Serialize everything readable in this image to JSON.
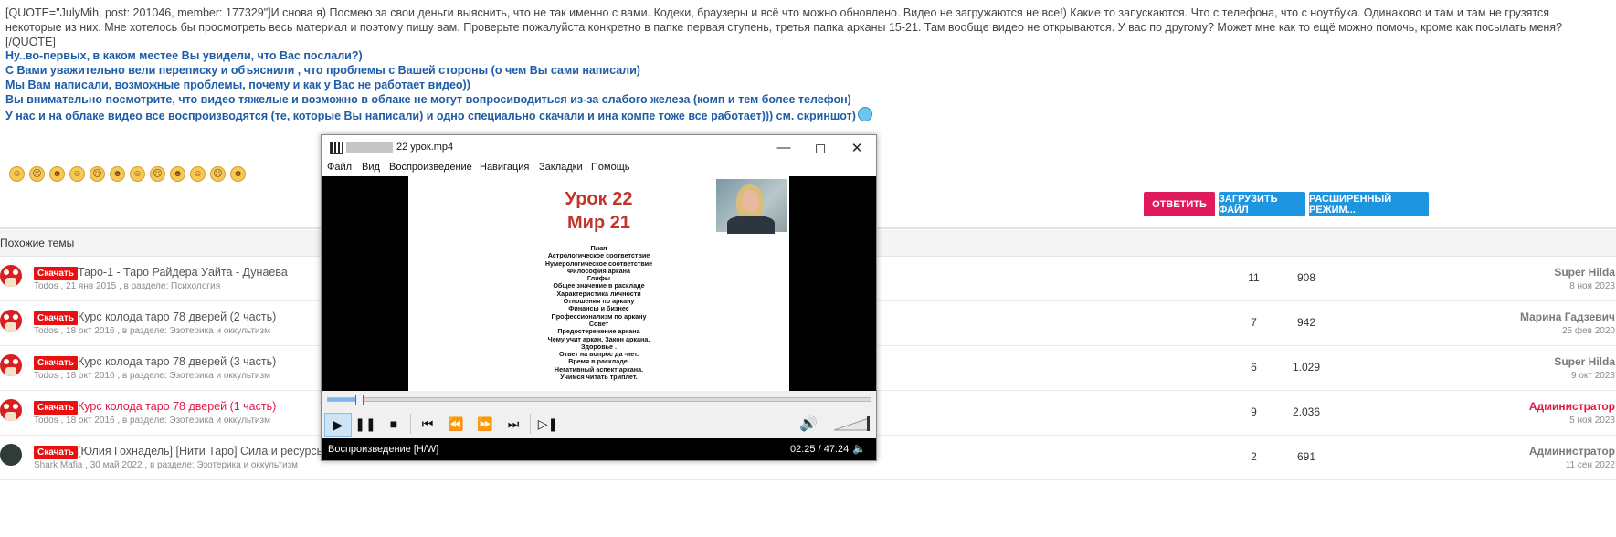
{
  "post": {
    "quote_text": "[QUOTE=\"JulyMih, post: 201046, member: 177329\"]И снова я) Посмею за свои деньги выяснить, что не так именно с вами. Кодеки, браузеры и всё что можно обновлено. Видео не загружаются не все!) Какие то запускаются. Что с телефона, что с ноутбука. Одинаково и там и там не грузятся некоторые из них. Мне хотелось бы просмотреть весь материал и поэтому пишу вам. Проверьте пожалуйста конкретно в папке первая ступень, третья папка арканы 15-21. Там вообще видео не открываются. У вас по другому? Может мне как то ещё можно помочь, кроме как посылать меня?",
    "quote_end": "[/QUOTE]",
    "reply_lines": [
      "Ну..во-первых, в каком местее Вы увидели, что Вас послали?)",
      "С Вами уважительно вели переписку и объяснили , что проблемы с Вашей стороны (о чем Вы сами написали)",
      "Мы Вам написали, возможные проблемы, почему и как у Вас не работает видео))",
      "Вы внимательно посмотрите, что видео тяжелые и возможно в облаке не могут вопросиводиться из-за слабого железа (комп и тем более телефон)",
      "У нас и на облаке видео все воспроизводятся (те, которые Вы написали) и одно специально скачали и ина компе тоже все работает))) см. скриншот)"
    ]
  },
  "smilies": [
    "☺",
    "☹",
    "☻",
    "☺",
    "☹",
    "☻",
    "☺",
    "☹",
    "☻",
    "☺",
    "☹",
    "☻"
  ],
  "buttons": {
    "reply": "ОТВЕТИТЬ",
    "upload": "ЗАГРУЗИТЬ ФАЙЛ",
    "advanced": "РАСШИРЕННЫЙ РЕЖИМ..."
  },
  "similar": {
    "heading": "Похожие темы",
    "threads": [
      {
        "badge": "Скачать",
        "title": "Таро-1 - Таро Райдера Уайта - Дунаева",
        "meta": "Todos , 21 янв 2015 , в разделе: Психология",
        "replies": "11",
        "views": "908",
        "last_user": "Super Hilda",
        "last_date": "8 ноя 2023",
        "hot": false,
        "admin": false
      },
      {
        "badge": "Скачать",
        "title": "Курс колода таро 78 дверей (2 часть)",
        "meta": "Todos , 18 окт 2016 , в разделе: Эзотерика и оккультизм",
        "replies": "7",
        "views": "942",
        "last_user": "Марина Гадзевич",
        "last_date": "25 фев 2020",
        "hot": false,
        "admin": false
      },
      {
        "badge": "Скачать",
        "title": "Курс колода таро 78 дверей (3 часть)",
        "meta": "Todos , 18 окт 2016 , в разделе: Эзотерика и оккультизм",
        "replies": "6",
        "views": "1.029",
        "last_user": "Super Hilda",
        "last_date": "9 окт 2023",
        "hot": false,
        "admin": false
      },
      {
        "badge": "Скачать",
        "title": "Курс колода таро 78 дверей (1 часть)",
        "meta": "Todos , 18 окт 2016 , в разделе: Эзотерика и оккультизм",
        "replies": "9",
        "views": "2.036",
        "last_user": "Администратор",
        "last_date": "5 ноя 2023",
        "hot": true,
        "admin": true
      },
      {
        "badge": "Скачать",
        "title": "[Юлия Гохнадель] [Нити Таро] Сила и ресурсы Род",
        "meta": "Shark Mafia , 30 май 2022 , в разделе: Эзотерика и оккультизм",
        "replies": "2",
        "views": "691",
        "last_user": "Администратор",
        "last_date": "11 сен 2022",
        "hot": false,
        "admin": false
      }
    ]
  },
  "player": {
    "window_title": "22 урок.mp4",
    "menu": [
      "Файл",
      "Вид",
      "Воспроизведение",
      "Навигация",
      "Закладки",
      "Помощь"
    ],
    "slide_title_1": "Урок 22",
    "slide_title_2": "Мир 21",
    "plan_lines": [
      "План",
      "Астрологическое соответствие",
      "Нумерологическое соответствие",
      "Философия аркана",
      "Глифы",
      "Общее значение в раскладе",
      "Характеристика личности",
      "Отношения по аркану",
      "Финансы и бизнес",
      "Профессионализм по аркану",
      "Совет",
      "Предостережение аркана",
      "Чему учит аркан. Закон аркана.",
      "Здоровье .",
      "Ответ на вопрос да -нет.",
      "Время в раскладе.",
      "Негативный аспект аркана.",
      "Учимся читать триплет."
    ],
    "progress": 0.053,
    "volume": 1.0,
    "status_left": "Воспроизведение [H/W]",
    "status_right": "02:25 / 47:24"
  }
}
